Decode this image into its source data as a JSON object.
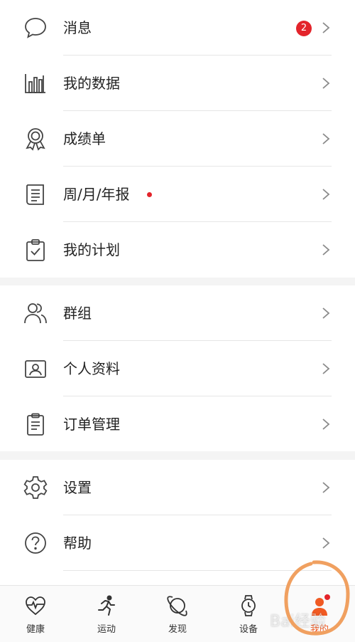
{
  "sections": [
    {
      "items": [
        {
          "id": "messages",
          "label": "消息",
          "icon": "chat-bubble-icon",
          "badge": "2"
        },
        {
          "id": "my-data",
          "label": "我的数据",
          "icon": "bar-chart-icon"
        },
        {
          "id": "report-card",
          "label": "成绩单",
          "icon": "medal-icon"
        },
        {
          "id": "reports",
          "label": "周/月/年报",
          "icon": "report-icon",
          "dot": true
        },
        {
          "id": "my-plan",
          "label": "我的计划",
          "icon": "clipboard-check-icon"
        }
      ]
    },
    {
      "items": [
        {
          "id": "groups",
          "label": "群组",
          "icon": "group-icon"
        },
        {
          "id": "profile",
          "label": "个人资料",
          "icon": "id-card-icon"
        },
        {
          "id": "orders",
          "label": "订单管理",
          "icon": "order-list-icon"
        }
      ]
    },
    {
      "items": [
        {
          "id": "settings",
          "label": "设置",
          "icon": "gear-icon"
        },
        {
          "id": "help",
          "label": "帮助",
          "icon": "help-icon"
        }
      ]
    }
  ],
  "tabbar": {
    "tabs": [
      {
        "id": "health",
        "label": "健康",
        "icon": "heart-pulse-icon"
      },
      {
        "id": "exercise",
        "label": "运动",
        "icon": "running-icon"
      },
      {
        "id": "discover",
        "label": "发现",
        "icon": "planet-icon"
      },
      {
        "id": "devices",
        "label": "设备",
        "icon": "watch-icon"
      },
      {
        "id": "me",
        "label": "我的",
        "icon": "person-icon",
        "active": true
      }
    ]
  },
  "watermark": "Bai经验",
  "colors": {
    "accent": "#f05a23",
    "badge": "#e3242b",
    "annotation": "#f0a060"
  }
}
